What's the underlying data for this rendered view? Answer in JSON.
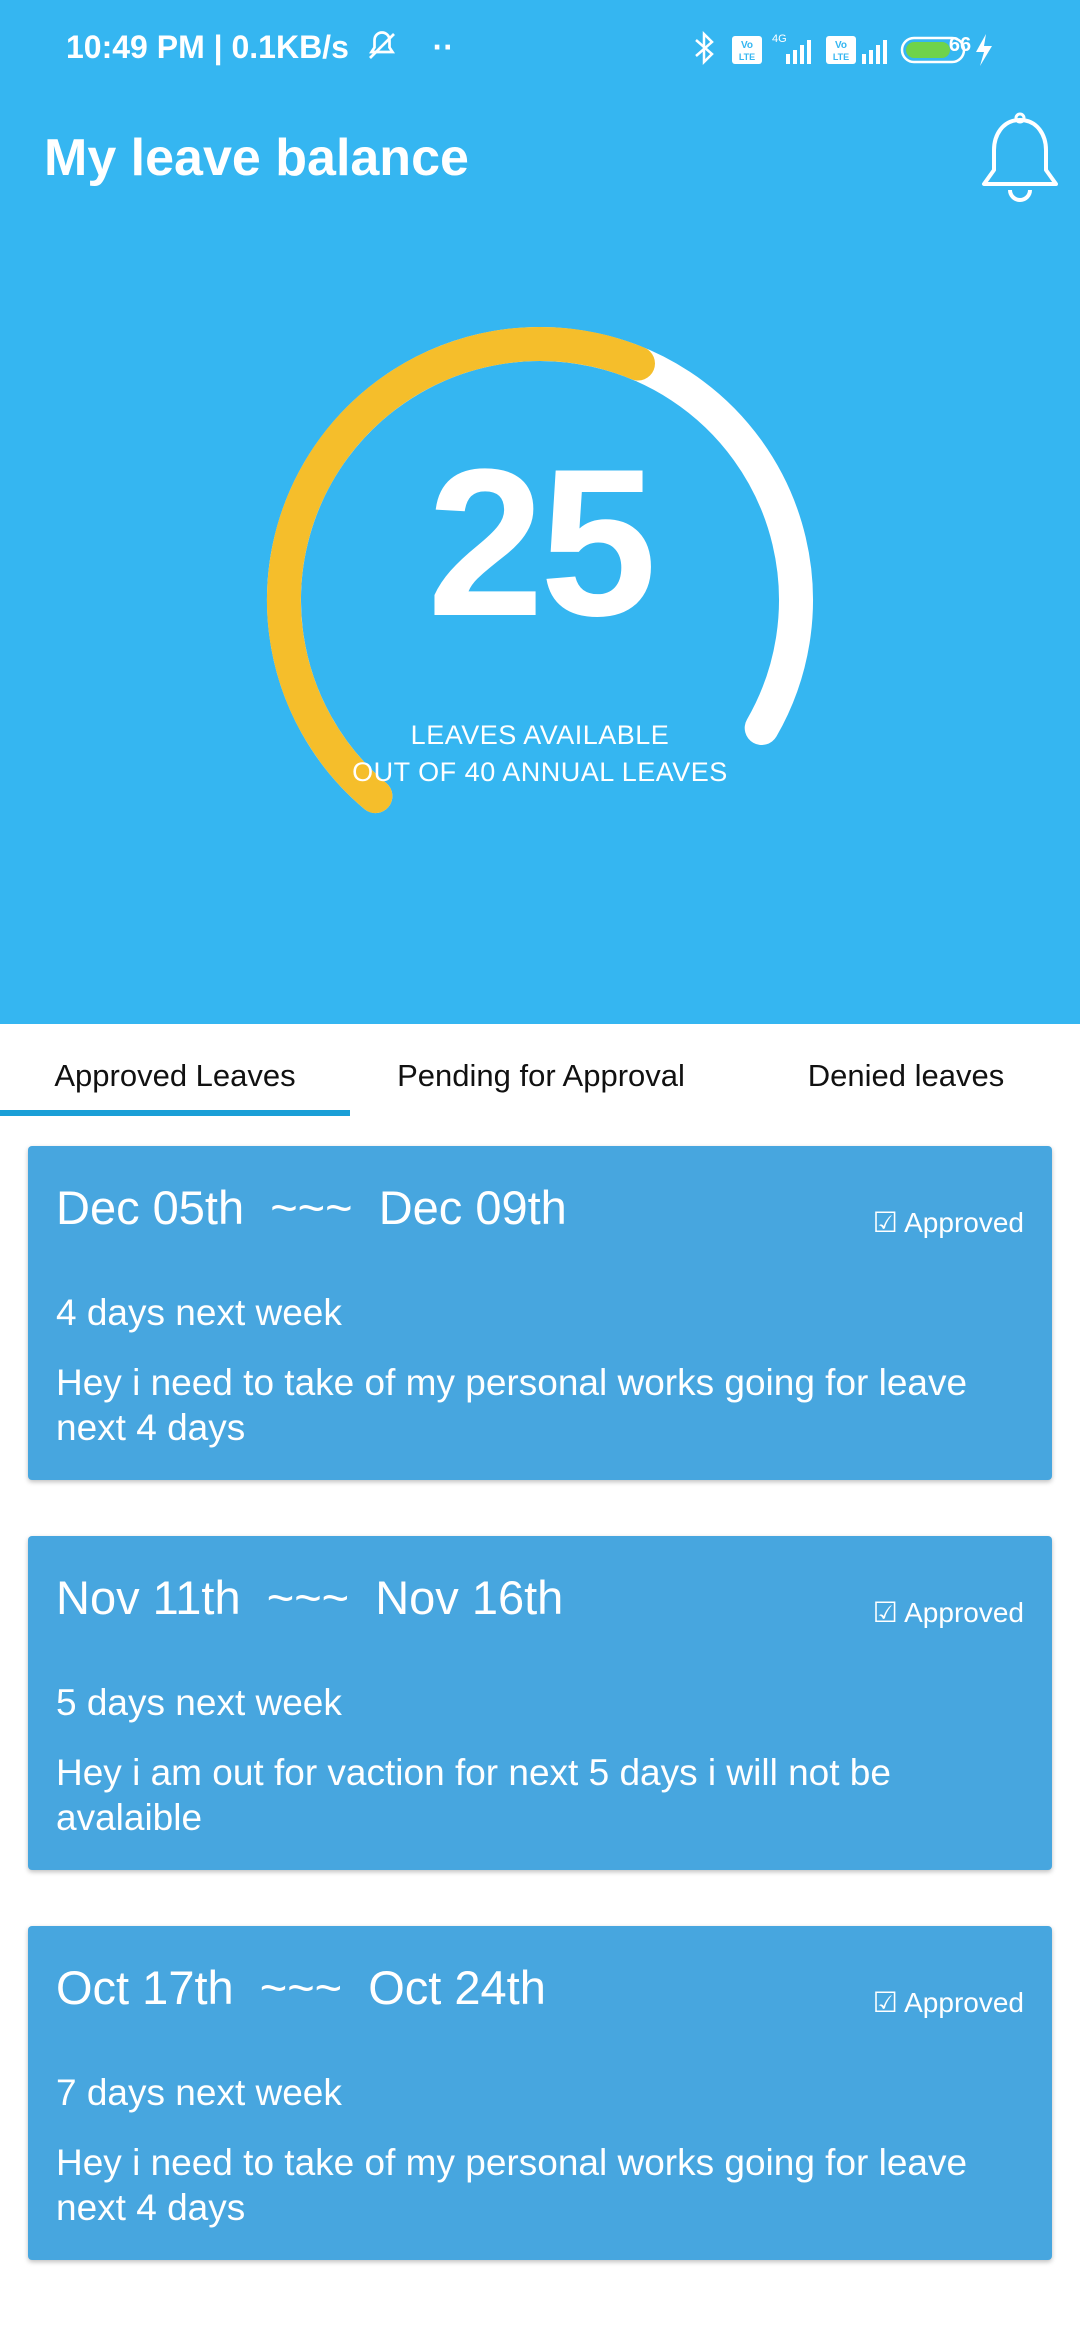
{
  "status_bar": {
    "left_text": "10:49 PM | 0.1KB/s",
    "dots": "··",
    "battery": "66"
  },
  "header": {
    "title": "My leave balance"
  },
  "gauge": {
    "available": "25",
    "total": 40,
    "label_line1": "LEAVES AVAILABLE",
    "label_line2": "OUT OF 40 ANNUAL LEAVES",
    "colors": {
      "used": "#f5be2b",
      "remaining": "#ffffff"
    }
  },
  "tabs": [
    {
      "label": "Approved Leaves",
      "active": true
    },
    {
      "label": "Pending for Approval",
      "active": false
    },
    {
      "label": "Denied leaves",
      "active": false
    }
  ],
  "leaves": [
    {
      "dates": "Dec 05th  ~~~  Dec 09th",
      "status": "☑ Approved",
      "days": "4 days next week",
      "reason": "Hey i need to take of my personal works going for leave next 4 days"
    },
    {
      "dates": "Nov 11th  ~~~  Nov 16th",
      "status": "☑ Approved",
      "days": "5 days next week",
      "reason": "Hey i am out for vaction for next 5 days i will not be avalaible"
    },
    {
      "dates": "Oct 17th  ~~~  Oct 24th",
      "status": "☑ Approved",
      "days": "7 days next week",
      "reason": "Hey i need to take of my personal works going for leave next 4 days"
    }
  ],
  "colors": {
    "header_bg": "#35b6f1",
    "card_bg": "#47a6df",
    "tab_indicator": "#1a9fd7"
  },
  "icons": [
    "bell-icon",
    "bluetooth-icon",
    "signal-icon",
    "battery-icon",
    "charging-icon",
    "mute-icon"
  ]
}
